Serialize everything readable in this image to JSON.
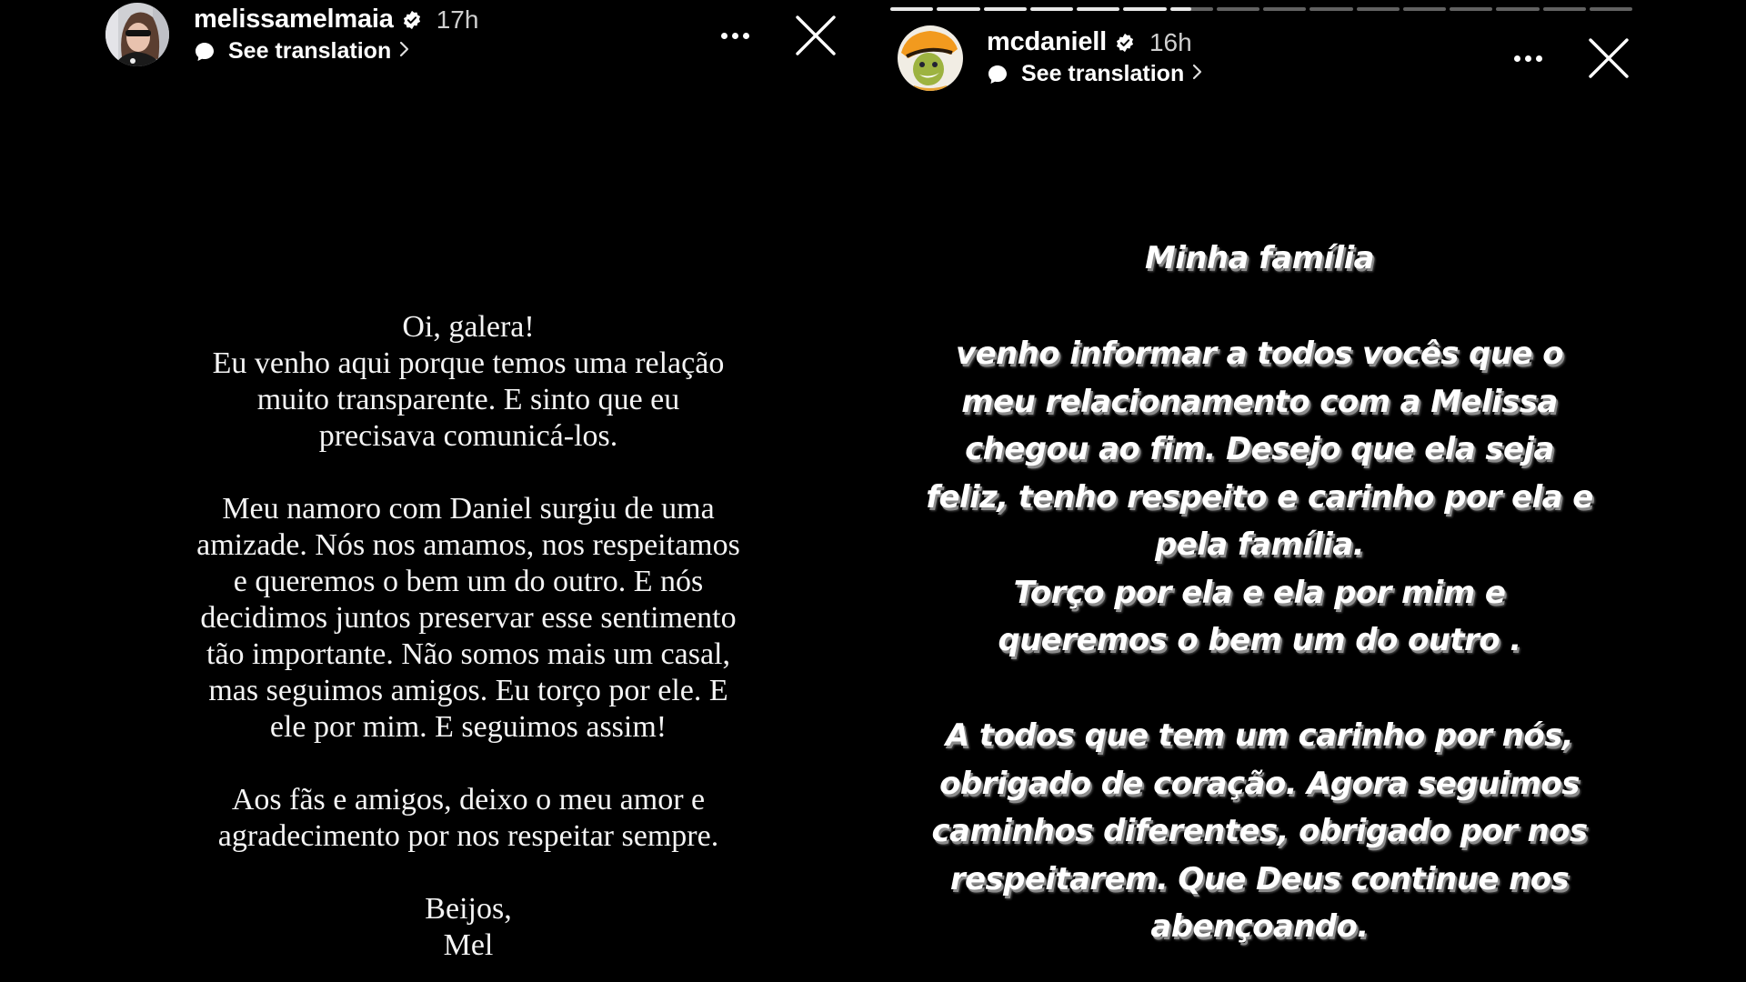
{
  "stories": {
    "left": {
      "username": "melissamelmaia",
      "verified": true,
      "time": "17h",
      "translation_label": "See translation",
      "icons": {
        "verified": "verified-badge-icon",
        "translation": "speech-bubble-icon",
        "chevron": "chevron-right-icon",
        "more": "more-options-icon",
        "close": "close-icon"
      },
      "text_lines": [
        "Oi, galera!",
        "Eu venho aqui porque temos uma relação",
        "muito transparente. E sinto que eu",
        "precisava comunicá-los.",
        "",
        "Meu namoro com Daniel surgiu de uma",
        "amizade. Nós nos amamos, nos respeitamos",
        "e queremos o bem um do outro. E nós",
        "decidimos juntos preservar esse sentimento",
        "tão importante. Não somos mais um casal,",
        "mas seguimos amigos. Eu torço por ele. E",
        "ele por mim. E seguimos assim!",
        "",
        "Aos fãs e amigos, deixo o meu amor e",
        "agradecimento por nos respeitar sempre.",
        "",
        "Beijos,",
        "Mel"
      ]
    },
    "right": {
      "username": "mcdaniell",
      "verified": true,
      "time": "16h",
      "translation_label": "See translation",
      "progress": {
        "segments": 16,
        "completed": 6,
        "current_fraction": 0.5
      },
      "icons": {
        "verified": "verified-badge-icon",
        "translation": "speech-bubble-icon",
        "chevron": "chevron-right-icon",
        "more": "more-options-icon",
        "close": "close-icon"
      },
      "text_lines": [
        "Minha família",
        "",
        "venho informar a todos vocês que o",
        "meu relacionamento com a Melissa",
        "chegou ao fim. Desejo que ela seja",
        "feliz, tenho respeito e carinho por ela e",
        "pela família.",
        "Torço por ela e ela por mim e",
        "queremos o bem um do outro .",
        "",
        "A todos que tem um carinho por nós,",
        "obrigado de coração. Agora seguimos",
        "caminhos diferentes, obrigado por nos",
        "respeitarem. Que Deus continue nos",
        "abençoando."
      ]
    }
  },
  "colors": {
    "background": "#000000",
    "text": "#ffffff",
    "progress_done": "#d9d9d9",
    "progress_pending": "#616161"
  }
}
